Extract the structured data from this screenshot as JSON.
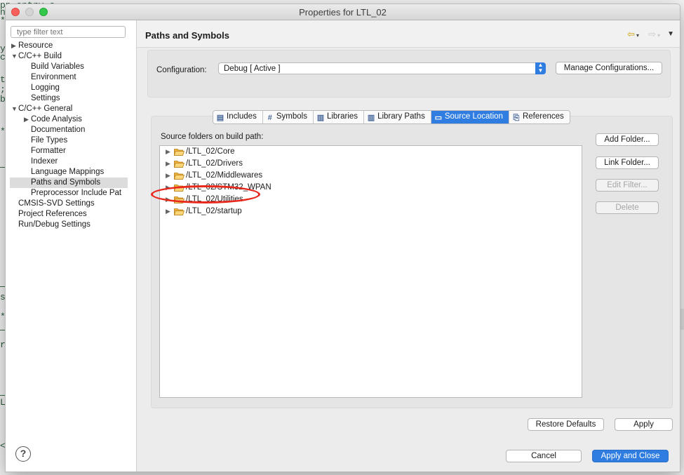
{
  "window": {
    "title": "Properties for LTL_02"
  },
  "background": {
    "code_lines": [
      "pp entry.c",
      "n",
      "*",
      "y",
      "c",
      "t",
      ";",
      "b",
      "*",
      "s",
      "*",
      "r",
      "L",
      "<"
    ]
  },
  "sidebar": {
    "filter_placeholder": "type filter text",
    "items": [
      {
        "label": "Resource",
        "level": 0,
        "twisty": "▶"
      },
      {
        "label": "C/C++ Build",
        "level": 0,
        "twisty": "▼"
      },
      {
        "label": "Build Variables",
        "level": 1,
        "twisty": ""
      },
      {
        "label": "Environment",
        "level": 1,
        "twisty": ""
      },
      {
        "label": "Logging",
        "level": 1,
        "twisty": ""
      },
      {
        "label": "Settings",
        "level": 1,
        "twisty": ""
      },
      {
        "label": "C/C++ General",
        "level": 0,
        "twisty": "▼"
      },
      {
        "label": "Code Analysis",
        "level": 1,
        "twisty": "▶"
      },
      {
        "label": "Documentation",
        "level": 1,
        "twisty": ""
      },
      {
        "label": "File Types",
        "level": 1,
        "twisty": ""
      },
      {
        "label": "Formatter",
        "level": 1,
        "twisty": ""
      },
      {
        "label": "Indexer",
        "level": 1,
        "twisty": ""
      },
      {
        "label": "Language Mappings",
        "level": 1,
        "twisty": ""
      },
      {
        "label": "Paths and Symbols",
        "level": 1,
        "twisty": "",
        "selected": true
      },
      {
        "label": "Preprocessor Include Pat",
        "level": 1,
        "twisty": ""
      },
      {
        "label": "CMSIS-SVD Settings",
        "level": 0,
        "twisty": ""
      },
      {
        "label": "Project References",
        "level": 0,
        "twisty": ""
      },
      {
        "label": "Run/Debug Settings",
        "level": 0,
        "twisty": ""
      }
    ],
    "help_symbol": "?"
  },
  "header": {
    "title": "Paths and Symbols",
    "back_icon": "⇦",
    "forward_icon": "⇨",
    "dropdown_caret": "▾",
    "menu_icon": "▼"
  },
  "config": {
    "label": "Configuration:",
    "value": "Debug  [ Active ]",
    "arrows": "▲\n▼",
    "manage_button": "Manage Configurations..."
  },
  "tabs": [
    {
      "label": "Includes",
      "icon": "▤",
      "icon_name": "includes-icon",
      "active": false
    },
    {
      "label": "Symbols",
      "icon": "#",
      "icon_name": "symbols-icon",
      "active": false
    },
    {
      "label": "Libraries",
      "icon": "▥",
      "icon_name": "libraries-icon",
      "active": false
    },
    {
      "label": "Library Paths",
      "icon": "▥",
      "icon_name": "library-paths-icon",
      "active": false
    },
    {
      "label": "Source Location",
      "icon": "▭",
      "icon_name": "source-location-icon",
      "active": true
    },
    {
      "label": "References",
      "icon": "⎘",
      "icon_name": "references-icon",
      "active": false
    }
  ],
  "source": {
    "label": "Source folders on build path:",
    "folders": [
      "/LTL_02/Core",
      "/LTL_02/Drivers",
      "/LTL_02/Middlewares",
      "/LTL_02/STM32_WPAN",
      "/LTL_02/Utilities",
      "/LTL_02/startup"
    ],
    "expand_glyph": "▶"
  },
  "side_buttons": {
    "add_folder": "Add Folder...",
    "link_folder": "Link Folder...",
    "edit_filter": "Edit Filter...",
    "delete": "Delete"
  },
  "footer": {
    "restore_defaults": "Restore Defaults",
    "apply": "Apply",
    "cancel": "Cancel",
    "apply_and_close": "Apply and Close"
  },
  "colors": {
    "accent": "#2f7de1",
    "annotation": "#e8281c",
    "folder": "#f2b33d"
  }
}
